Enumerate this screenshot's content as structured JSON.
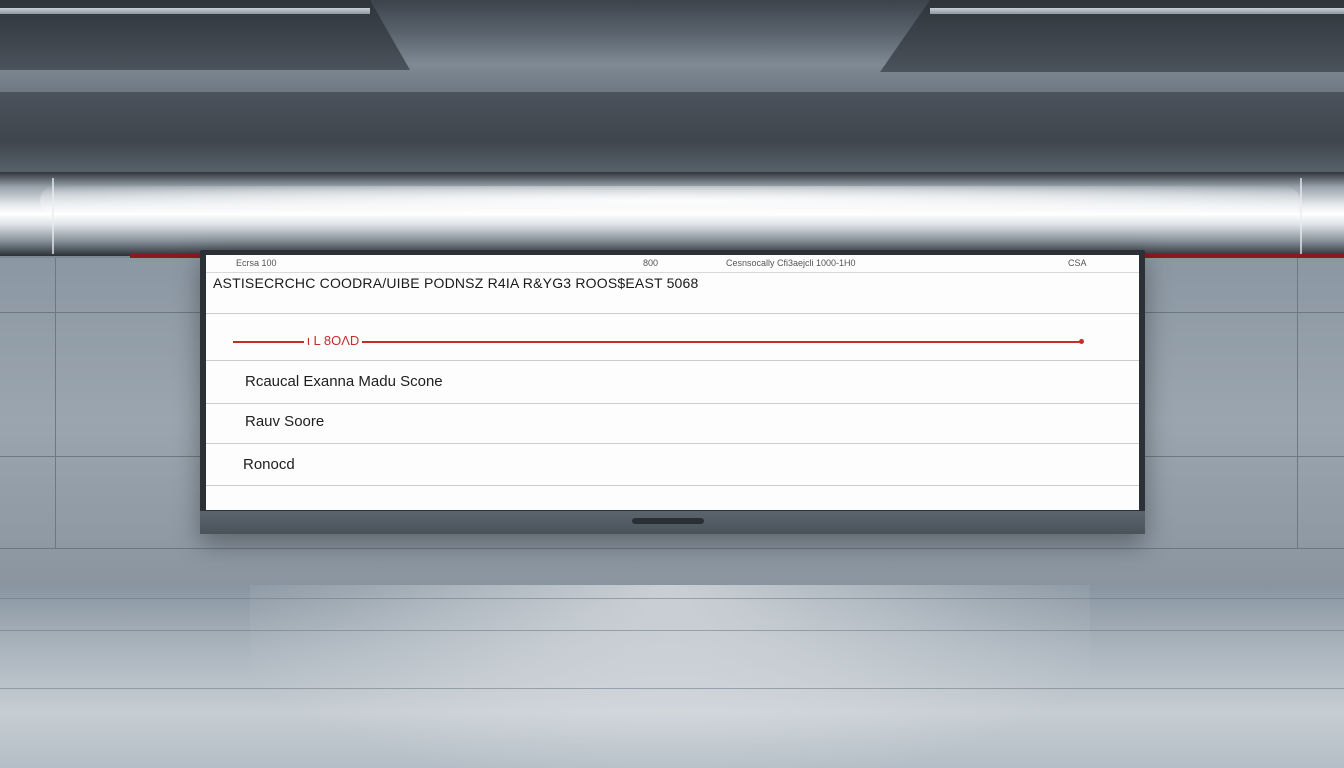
{
  "screen": {
    "top_small_labels": [
      "Ecrsa 100",
      "800",
      "Cesnsocally Cfi3aejcli 1000-1H0",
      "CSA"
    ],
    "header": "ASTISECRCHC COODRA/UIBE PODNSZ R4IA  R&YG3  ROOS$EAST 5068",
    "timeline_label": "ι L 8OΛD",
    "rows": [
      {
        "label": "Rcaucal  Exanna Madu Scone"
      },
      {
        "label": "Rauv Soore"
      },
      {
        "label": "Ronocd"
      }
    ],
    "colors": {
      "accent_red": "#c92b2b",
      "screen_bg": "#fdfdfd",
      "row_divider": "#c9cdd1"
    }
  }
}
